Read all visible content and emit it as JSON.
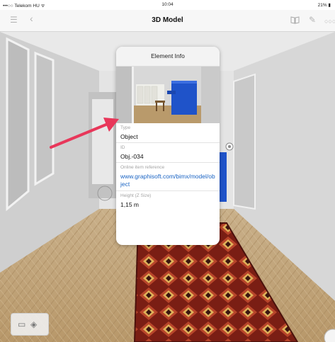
{
  "status": {
    "carrier": "•••○○ Telekom HU ᯤ",
    "time": "10:04",
    "battery": "21%"
  },
  "nav": {
    "title": "3D Model"
  },
  "popover": {
    "title": "Element Info",
    "fields": [
      {
        "label": "Type",
        "value": "Object"
      },
      {
        "label": "ID",
        "value": "Obj.-034"
      },
      {
        "label": "Online item reference",
        "value": "www.graphisoft.com/bimx/model/object"
      },
      {
        "label": "Height (Z Size)",
        "value": "1,15 m"
      }
    ]
  },
  "colors": {
    "link": "#1a64c4",
    "arrow": "#e8375a",
    "piano": "#1f53c9"
  }
}
